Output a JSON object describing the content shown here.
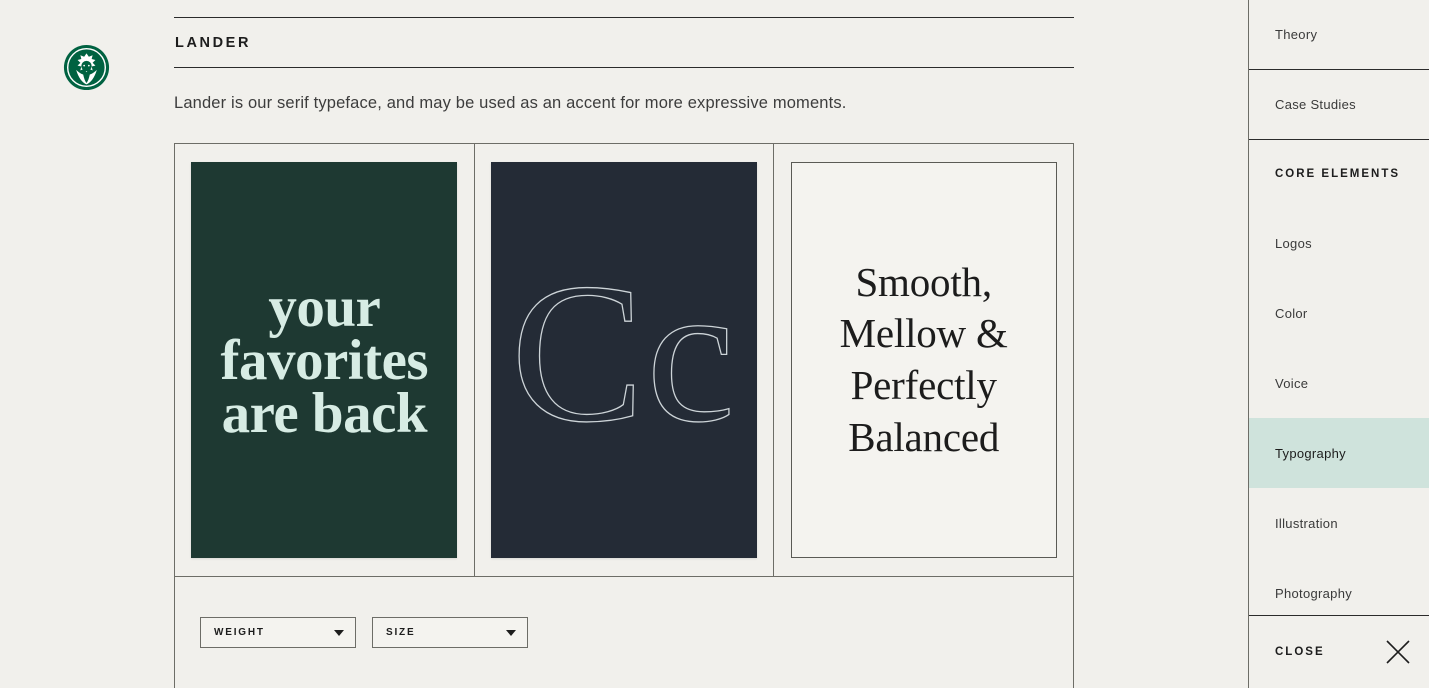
{
  "brand": {
    "logo_icon": "starbucks-siren-logo",
    "logo_color": "#006241"
  },
  "colors": {
    "page_background": "#f1f0ec",
    "rule": "#2b2b2b",
    "border": "#6d6d67",
    "accent_highlight": "#cfe3dc",
    "poster_green": "#1e3932",
    "poster_green_text": "#d7ece4",
    "poster_navy": "#242b36",
    "poster_navy_stroke": "#cdd4d8",
    "poster_light": "#f4f3ef",
    "poster_light_text": "#1c1c1c"
  },
  "main": {
    "section_title": "LANDER",
    "description": "Lander is our serif typeface, and may be used as an accent for more expressive moments.",
    "posters": [
      {
        "id": "poster-favorites",
        "style": "green",
        "lines": [
          "your",
          "favorites",
          "are back"
        ]
      },
      {
        "id": "poster-cc-glyphs",
        "style": "navy",
        "glyphs": "Cc"
      },
      {
        "id": "poster-smooth-mellow",
        "style": "light",
        "lines": [
          "Smooth,",
          "Mellow &",
          "Perfectly",
          "Balanced"
        ]
      }
    ],
    "controls": [
      {
        "id": "weight-select",
        "label": "WEIGHT",
        "icon": "chevron-down-icon"
      },
      {
        "id": "size-select",
        "label": "SIZE",
        "icon": "chevron-down-icon"
      }
    ]
  },
  "sidebar": {
    "top_items": [
      {
        "id": "theory",
        "label": "Theory",
        "active": false
      },
      {
        "id": "case-studies",
        "label": "Case Studies",
        "active": false
      }
    ],
    "group_title": "CORE ELEMENTS",
    "group_items": [
      {
        "id": "logos",
        "label": "Logos",
        "active": false
      },
      {
        "id": "color",
        "label": "Color",
        "active": false
      },
      {
        "id": "voice",
        "label": "Voice",
        "active": false
      },
      {
        "id": "typography",
        "label": "Typography",
        "active": true
      },
      {
        "id": "illustration",
        "label": "Illustration",
        "active": false
      },
      {
        "id": "photography",
        "label": "Photography",
        "active": false
      }
    ],
    "close": {
      "label": "CLOSE",
      "icon": "close-x-icon"
    }
  }
}
